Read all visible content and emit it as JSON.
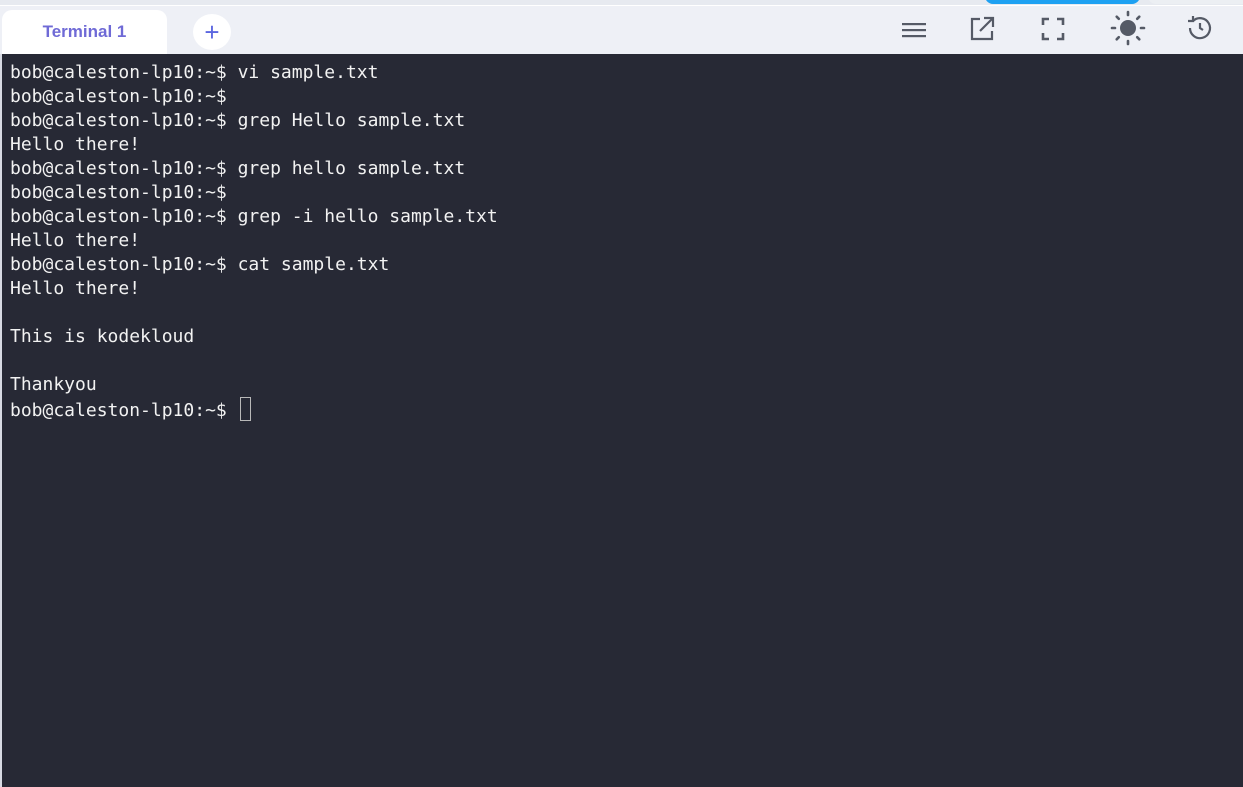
{
  "tab": {
    "label": "Terminal 1",
    "active_color": "#6f6ad6"
  },
  "add_tab": {
    "label": "+"
  },
  "toolbar": {
    "icons": [
      "menu-icon",
      "open-external-icon",
      "fullscreen-icon",
      "theme-sun-icon",
      "restore-history-icon"
    ]
  },
  "terminal": {
    "background": "#272935",
    "foreground": "#f2f2f2",
    "lines": [
      "bob@caleston-lp10:~$ vi sample.txt",
      "bob@caleston-lp10:~$",
      "bob@caleston-lp10:~$ grep Hello sample.txt",
      "Hello there!",
      "bob@caleston-lp10:~$ grep hello sample.txt",
      "bob@caleston-lp10:~$",
      "bob@caleston-lp10:~$ grep -i hello sample.txt",
      "Hello there!",
      "bob@caleston-lp10:~$ cat sample.txt",
      "Hello there!",
      "",
      "This is kodekloud",
      "",
      "Thankyou"
    ],
    "prompt": "bob@caleston-lp10:~$ "
  }
}
